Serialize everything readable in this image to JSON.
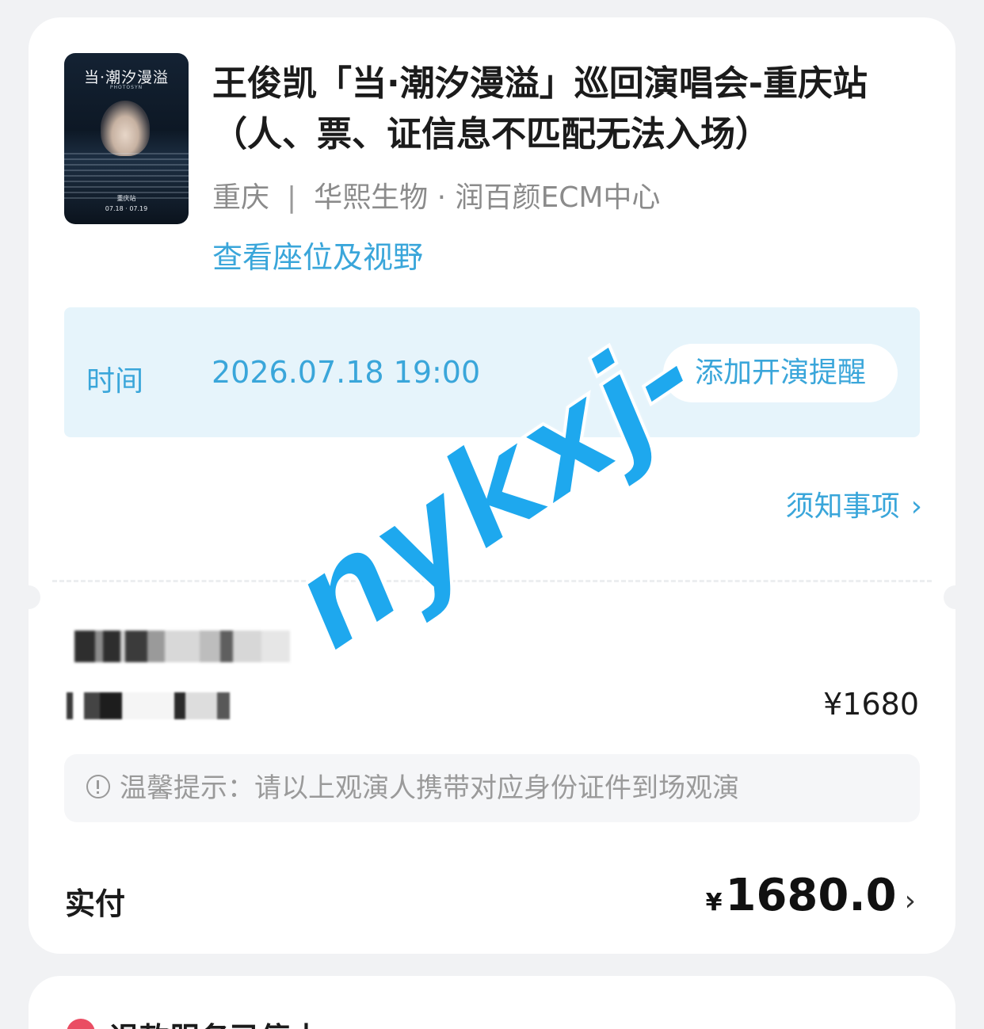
{
  "event": {
    "poster": {
      "title": "当·潮汐漫溢",
      "subtitle": "PHOTOSYN",
      "sign": "重庆站",
      "date": "07.18 · 07.19"
    },
    "title": "王俊凯「当·潮汐漫溢」巡回演唱会-重庆站（人、票、证信息不匹配无法入场）",
    "city": "重庆",
    "separator": "|",
    "venue": "华熙生物 · 润百颜ECM中心",
    "seat_link": "查看座位及视野"
  },
  "time": {
    "label": "时间",
    "value": "2026.07.18 19:00",
    "remind_button": "添加开演提醒"
  },
  "notice": {
    "label": "须知事项",
    "chevron": "›"
  },
  "ticket": {
    "price": "¥1680"
  },
  "tip": {
    "icon": "info-circle-icon",
    "text": "温馨提示：请以上观演人携带对应身份证件到场观演"
  },
  "payment": {
    "label": "实付",
    "currency": "¥",
    "amount": "1680.0",
    "chevron": "›"
  },
  "refund": {
    "icon": "alert-dot-icon",
    "text": "退款服务已停止"
  },
  "watermark": {
    "text": "nykxj-"
  },
  "colors": {
    "accent": "#3aa6da",
    "time_bg": "#e6f4fb",
    "page_bg": "#f1f2f4",
    "refund_icon": "#ea4d63",
    "watermark": "#1ea8ee"
  }
}
